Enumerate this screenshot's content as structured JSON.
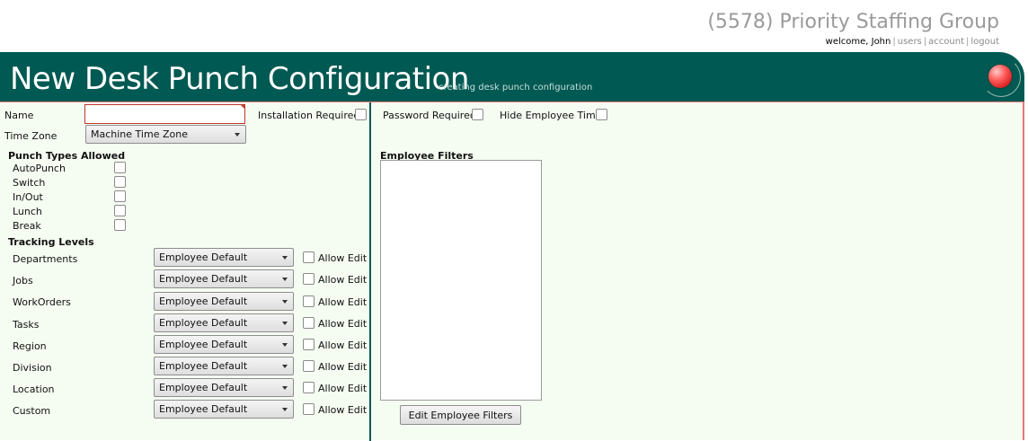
{
  "header": {
    "company": "(5578) Priority Staffing Group",
    "welcome": "welcome, John",
    "links": [
      "users",
      "account",
      "logout"
    ]
  },
  "banner": {
    "title": "New Desk Punch Configuration",
    "subtitle": "creating desk punch configuration"
  },
  "form": {
    "name_label": "Name",
    "name_value": "",
    "installation_required_label": "Installation Required",
    "password_required_label": "Password Required",
    "hide_employee_time_label": "Hide Employee Time",
    "time_zone_label": "Time Zone",
    "time_zone_value": "Machine Time Zone"
  },
  "punch_types": {
    "heading": "Punch Types Allowed",
    "items": [
      "AutoPunch",
      "Switch",
      "In/Out",
      "Lunch",
      "Break"
    ]
  },
  "tracking": {
    "heading": "Tracking Levels",
    "allow_edit_label": "Allow Edit",
    "levels": [
      {
        "label": "Departments",
        "value": "Employee Default"
      },
      {
        "label": "Jobs",
        "value": "Employee Default"
      },
      {
        "label": "WorkOrders",
        "value": "Employee Default"
      },
      {
        "label": "Tasks",
        "value": "Employee Default"
      },
      {
        "label": "Region",
        "value": "Employee Default"
      },
      {
        "label": "Division",
        "value": "Employee Default"
      },
      {
        "label": "Location",
        "value": "Employee Default"
      },
      {
        "label": "Custom",
        "value": "Employee Default"
      }
    ]
  },
  "employee_filters": {
    "heading": "Employee Filters",
    "button_label": "Edit Employee Filters"
  },
  "colors": {
    "banner": "#005952",
    "panel_bg": "#f5fdf2",
    "accent_red": "#e47878"
  }
}
